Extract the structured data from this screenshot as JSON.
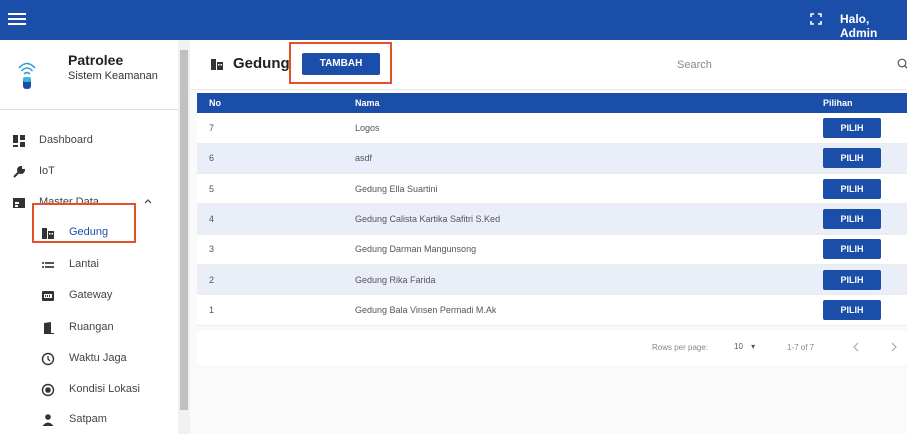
{
  "header": {
    "greeting": "Halo, Admin",
    "accent": "#1b4ea8"
  },
  "brand": {
    "name": "Patrolee",
    "subtitle": "Sistem Keamanan"
  },
  "sidebar": {
    "items": [
      {
        "label": "Dashboard",
        "icon": "dashboard-icon"
      },
      {
        "label": "IoT",
        "icon": "wrench-icon"
      },
      {
        "label": "Master Data",
        "icon": "data-icon"
      }
    ],
    "sub_items": [
      {
        "label": "Gedung",
        "icon": "building-icon",
        "active": true
      },
      {
        "label": "Lantai",
        "icon": "layers-icon"
      },
      {
        "label": "Gateway",
        "icon": "gateway-icon"
      },
      {
        "label": "Ruangan",
        "icon": "room-icon"
      },
      {
        "label": "Waktu Jaga",
        "icon": "clock-icon"
      },
      {
        "label": "Kondisi Lokasi",
        "icon": "radio-icon"
      },
      {
        "label": "Satpam",
        "icon": "person-icon"
      }
    ]
  },
  "page": {
    "title": "Gedung",
    "add_label": "TAMBAH",
    "search_placeholder": "Search"
  },
  "table": {
    "columns": [
      "No",
      "Nama",
      "Pilihan"
    ],
    "rows": [
      {
        "no": "7",
        "nama": "Logos",
        "action": "PILIH"
      },
      {
        "no": "6",
        "nama": "asdf",
        "action": "PILIH"
      },
      {
        "no": "5",
        "nama": "Gedung Ella Suartini",
        "action": "PILIH"
      },
      {
        "no": "4",
        "nama": "Gedung Calista Kartika Safitri S.Ked",
        "action": "PILIH"
      },
      {
        "no": "3",
        "nama": "Gedung Darman Mangunsong",
        "action": "PILIH"
      },
      {
        "no": "2",
        "nama": "Gedung Rika Farida",
        "action": "PILIH"
      },
      {
        "no": "1",
        "nama": "Gedung Bala Vinsen Permadi M.Ak",
        "action": "PILIH"
      }
    ]
  },
  "pagination": {
    "rows_per_page_label": "Rows per page:",
    "rows_per_page": "10",
    "range": "1-7 of 7"
  }
}
